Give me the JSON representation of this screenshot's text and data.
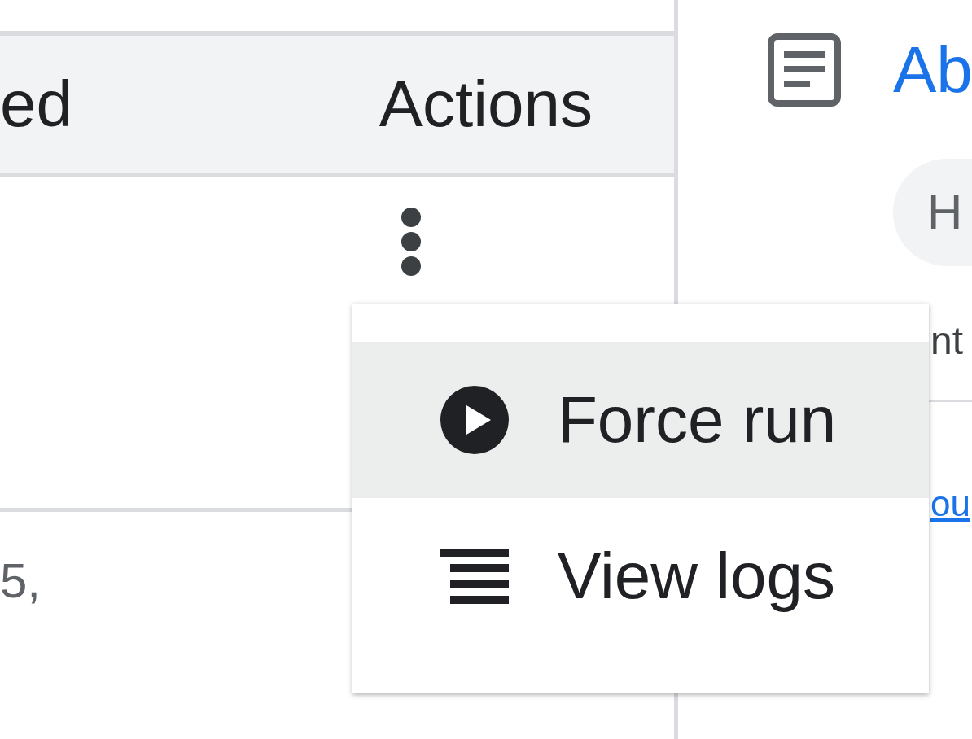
{
  "table": {
    "columns": [
      "ed",
      "Actions"
    ],
    "rows": [
      {
        "kind": "actions"
      },
      {
        "kind": "text",
        "column_1": "5,"
      }
    ]
  },
  "menu": {
    "items": [
      {
        "label": "Force run",
        "highlighted": true
      },
      {
        "label": "View logs",
        "highlighted": false
      }
    ]
  },
  "side_panel": {
    "title": "Ab",
    "chip": "H",
    "text": "nt",
    "link": "ou"
  }
}
